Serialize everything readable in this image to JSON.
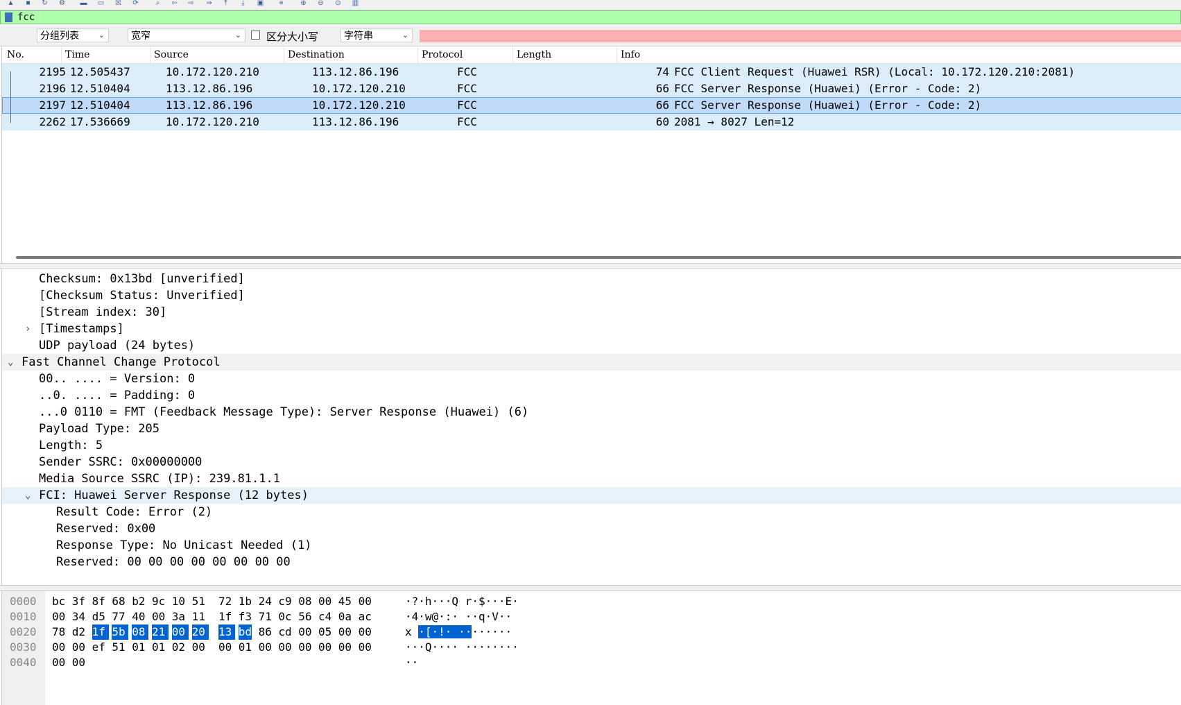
{
  "toolbar": {
    "icons": [
      "shark-fin-icon",
      "stop-icon",
      "restart-icon",
      "options-icon",
      "open-folder-icon",
      "file-icon",
      "close-file-icon",
      "reload-icon",
      "find-icon",
      "back-arrow-icon",
      "forward-arrow-icon",
      "go-to-packet-icon",
      "first-packet-icon",
      "last-packet-icon",
      "autoscroll-icon",
      "colorize-icon",
      "zoom-in-icon",
      "zoom-out-icon",
      "normal-size-icon",
      "resize-columns-icon"
    ]
  },
  "filter": {
    "value": "fcc",
    "background": "#afffaf"
  },
  "search": {
    "scope": "分组列表",
    "charset": "宽窄",
    "case_label": "区分大小写",
    "case_checked": false,
    "type": "字符串",
    "input_background": "#ffafaf"
  },
  "packet_list": {
    "columns": [
      "No.",
      "Time",
      "Source",
      "Destination",
      "Protocol",
      "Length",
      "Info"
    ],
    "rows": [
      {
        "no": "2195",
        "time": "12.505437",
        "source": "10.172.120.210",
        "destination": "113.12.86.196",
        "protocol": "FCC",
        "length": "74",
        "info": "FCC Client Request (Huawei RSR) (Local: 10.172.120.210:2081)",
        "selected": false
      },
      {
        "no": "2196",
        "time": "12.510404",
        "source": "113.12.86.196",
        "destination": "10.172.120.210",
        "protocol": "FCC",
        "length": "66",
        "info": "FCC Server Response (Huawei) (Error - Code: 2)",
        "selected": false
      },
      {
        "no": "2197",
        "time": "12.510404",
        "source": "113.12.86.196",
        "destination": "10.172.120.210",
        "protocol": "FCC",
        "length": "66",
        "info": "FCC Server Response (Huawei) (Error - Code: 2)",
        "selected": true
      },
      {
        "no": "2262",
        "time": "17.536669",
        "source": "10.172.120.210",
        "destination": "113.12.86.196",
        "protocol": "FCC",
        "length": "60",
        "info": "2081 → 8027 Len=12",
        "selected": false
      }
    ],
    "row_color": "#dcedfa",
    "selected_color": "#c0daf7"
  },
  "details": [
    {
      "text": "Checksum: 0x13bd [unverified]",
      "indent": 2,
      "arrow": "",
      "highlight": ""
    },
    {
      "text": "[Checksum Status: Unverified]",
      "indent": 2,
      "arrow": "",
      "highlight": ""
    },
    {
      "text": "[Stream index: 30]",
      "indent": 2,
      "arrow": "",
      "highlight": ""
    },
    {
      "text": "[Timestamps]",
      "indent": 2,
      "arrow": "›",
      "highlight": ""
    },
    {
      "text": "UDP payload (24 bytes)",
      "indent": 2,
      "arrow": "",
      "highlight": ""
    },
    {
      "text": "Fast Channel Change Protocol",
      "indent": 1,
      "arrow": "⌄",
      "highlight": "grey"
    },
    {
      "text": "00.. .... = Version: 0",
      "indent": 2,
      "arrow": "",
      "highlight": ""
    },
    {
      "text": "..0. .... = Padding: 0",
      "indent": 2,
      "arrow": "",
      "highlight": ""
    },
    {
      "text": "...0 0110 = FMT (Feedback Message Type): Server Response (Huawei) (6)",
      "indent": 2,
      "arrow": "",
      "highlight": ""
    },
    {
      "text": "Payload Type: 205",
      "indent": 2,
      "arrow": "",
      "highlight": ""
    },
    {
      "text": "Length: 5",
      "indent": 2,
      "arrow": "",
      "highlight": ""
    },
    {
      "text": "Sender SSRC: 0x00000000",
      "indent": 2,
      "arrow": "",
      "highlight": ""
    },
    {
      "text": "Media Source SSRC (IP): 239.81.1.1",
      "indent": 2,
      "arrow": "",
      "highlight": ""
    },
    {
      "text": "FCI: Huawei Server Response (12 bytes)",
      "indent": 2,
      "arrow": "⌄",
      "highlight": "blue"
    },
    {
      "text": "Result Code: Error (2)",
      "indent": 3,
      "arrow": "",
      "highlight": ""
    },
    {
      "text": "Reserved: 0x00",
      "indent": 3,
      "arrow": "",
      "highlight": ""
    },
    {
      "text": "Response Type: No Unicast Needed (1)",
      "indent": 3,
      "arrow": "",
      "highlight": ""
    },
    {
      "text": "Reserved: 00 00 00 00 00 00 00 00",
      "indent": 3,
      "arrow": "",
      "highlight": ""
    }
  ],
  "bytes": [
    {
      "offset": "0000",
      "hex": [
        "bc",
        "3f",
        "8f",
        "68",
        "b2",
        "9c",
        "10",
        "51",
        "72",
        "1b",
        "24",
        "c9",
        "08",
        "00",
        "45",
        "00"
      ],
      "ascii": "·?·h···Q r·$···E·"
    },
    {
      "offset": "0010",
      "hex": [
        "00",
        "34",
        "d5",
        "77",
        "40",
        "00",
        "3a",
        "11",
        "1f",
        "f3",
        "71",
        "0c",
        "56",
        "c4",
        "0a",
        "ac"
      ],
      "ascii": "·4·w@·:· ··q·V··"
    },
    {
      "offset": "0020",
      "hex": [
        "78",
        "d2",
        "1f",
        "5b",
        "08",
        "21",
        "00",
        "20",
        "13",
        "bd",
        "86",
        "cd",
        "00",
        "05",
        "00",
        "00"
      ],
      "ascii": "x··[·!· ········",
      "sel_hex_start": 2,
      "sel_hex_end": 9,
      "ascii_pre": "x ",
      "ascii_sel": "·[·!·  ··",
      "ascii_post": "······"
    },
    {
      "offset": "0030",
      "hex": [
        "00",
        "00",
        "ef",
        "51",
        "01",
        "01",
        "02",
        "00",
        "00",
        "01",
        "00",
        "00",
        "00",
        "00",
        "00",
        "00"
      ],
      "ascii": "···Q···· ········"
    },
    {
      "offset": "0040",
      "hex": [
        "00",
        "00"
      ],
      "ascii": "··"
    }
  ],
  "selection_color": "#0063d1"
}
